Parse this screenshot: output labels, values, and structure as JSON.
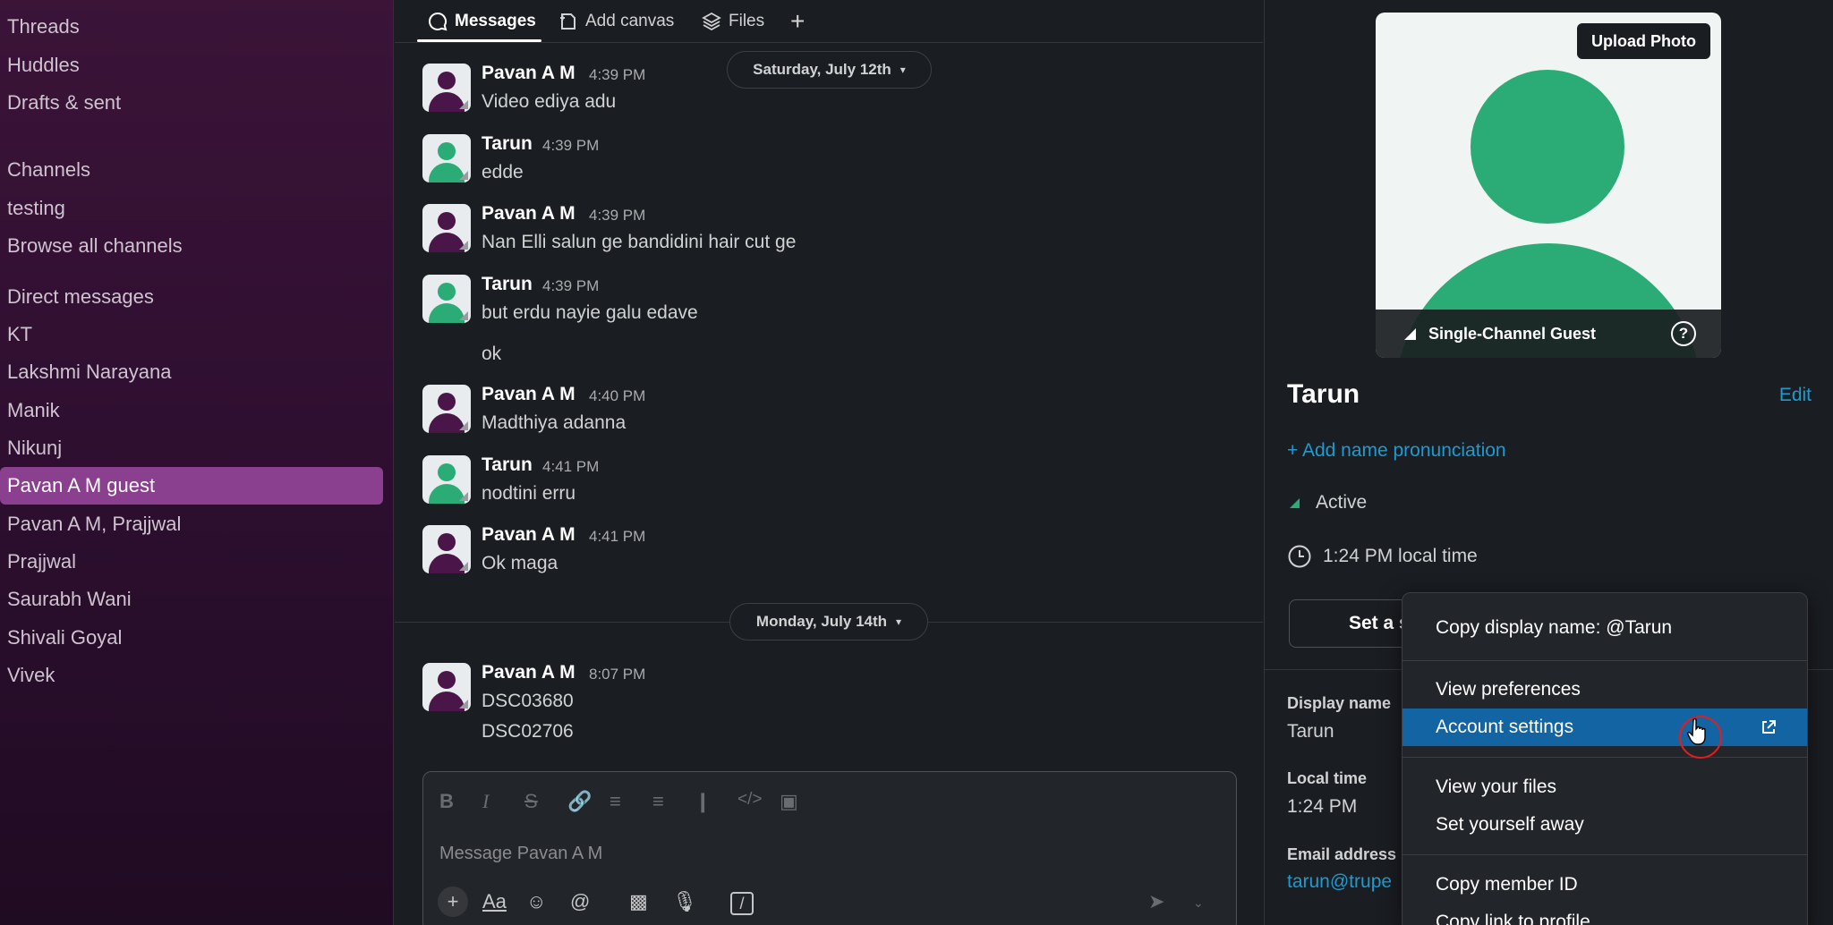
{
  "sidebar": {
    "items": [
      {
        "label": "Threads",
        "active": false
      },
      {
        "label": "Huddles",
        "active": false
      },
      {
        "label": "Drafts & sent",
        "active": false
      },
      {
        "label": "Channels",
        "active": false
      },
      {
        "label": "testing",
        "active": false
      },
      {
        "label": "Browse all channels",
        "active": false
      },
      {
        "label": "Direct messages",
        "active": false
      },
      {
        "label": "KT",
        "active": false
      },
      {
        "label": "Lakshmi Narayana",
        "active": false
      },
      {
        "label": "Manik",
        "active": false
      },
      {
        "label": "Nikunj",
        "active": false
      },
      {
        "label": "Pavan A M  guest",
        "active": true
      },
      {
        "label": "Pavan A M, Prajjwal",
        "active": false
      },
      {
        "label": "Prajjwal",
        "active": false
      },
      {
        "label": "Saurabh Wani",
        "active": false
      },
      {
        "label": "Shivali Goyal",
        "active": false
      },
      {
        "label": "Vivek",
        "active": false
      }
    ]
  },
  "tabs": [
    {
      "label": "Messages",
      "icon": "chat-bubble-icon",
      "active": true
    },
    {
      "label": "Add canvas",
      "icon": "canvas-icon",
      "active": false
    },
    {
      "label": "Files",
      "icon": "files-icon",
      "active": false
    }
  ],
  "dates": {
    "first": "Saturday, July 12th",
    "second": "Monday, July 14th"
  },
  "messages": [
    {
      "name": "Pavan A M",
      "time": "4:39 PM",
      "text": "Video ediya adu",
      "avatar": "purple"
    },
    {
      "name": "Tarun",
      "time": "4:39 PM",
      "text": "edde",
      "avatar": "green"
    },
    {
      "name": "Pavan A M",
      "time": "4:39 PM",
      "text": "Nan Elli salun ge bandidini hair cut ge",
      "avatar": "purple"
    },
    {
      "name": "Tarun",
      "time": "4:39 PM",
      "text": "but erdu nayie galu edave",
      "extra": "ok",
      "avatar": "green"
    },
    {
      "name": "Pavan A M",
      "time": "4:40 PM",
      "text": "Madthiya adanna",
      "avatar": "purple"
    },
    {
      "name": "Tarun",
      "time": "4:41 PM",
      "text": "nodtini erru",
      "avatar": "green"
    },
    {
      "name": "Pavan A M",
      "time": "4:41 PM",
      "text": "Ok maga",
      "avatar": "purple"
    },
    {
      "name": "Pavan A M",
      "time": "8:07 PM",
      "text": "DSC03680",
      "extra": "DSC02706",
      "avatar": "purple"
    }
  ],
  "composer": {
    "placeholder": "Message Pavan A M"
  },
  "profile": {
    "upload_label": "Upload Photo",
    "guest_label": "Single-Channel Guest",
    "name": "Tarun",
    "edit_label": "Edit",
    "pronunciation_label": "+ Add name pronunciation",
    "status": "Active",
    "local_time_text": "1:24 PM local time",
    "set_status_label": "Set a s",
    "display_name_label": "Display name",
    "display_name": "Tarun",
    "local_time_label": "Local time",
    "local_time": "1:24 PM",
    "email_label": "Email address",
    "email": "tarun@trupe"
  },
  "menu": {
    "items": [
      {
        "label": "Copy display name: @Tarun",
        "highlight": false
      },
      {
        "label": "View preferences",
        "highlight": false
      },
      {
        "label": "Account settings",
        "highlight": true
      },
      {
        "label": "View your files",
        "highlight": false
      },
      {
        "label": "Set yourself away",
        "highlight": false
      },
      {
        "label": "Copy member ID",
        "highlight": false
      },
      {
        "label": "Copy link to profile",
        "highlight": false
      }
    ]
  },
  "colors": {
    "sidebar_bg": "#3b1438",
    "active_item": "#8a3f8f",
    "accent_link": "#1d9bd1",
    "menu_highlight": "#1264a3",
    "avatar_green": "#2bac76",
    "avatar_purple": "#4a1548"
  }
}
